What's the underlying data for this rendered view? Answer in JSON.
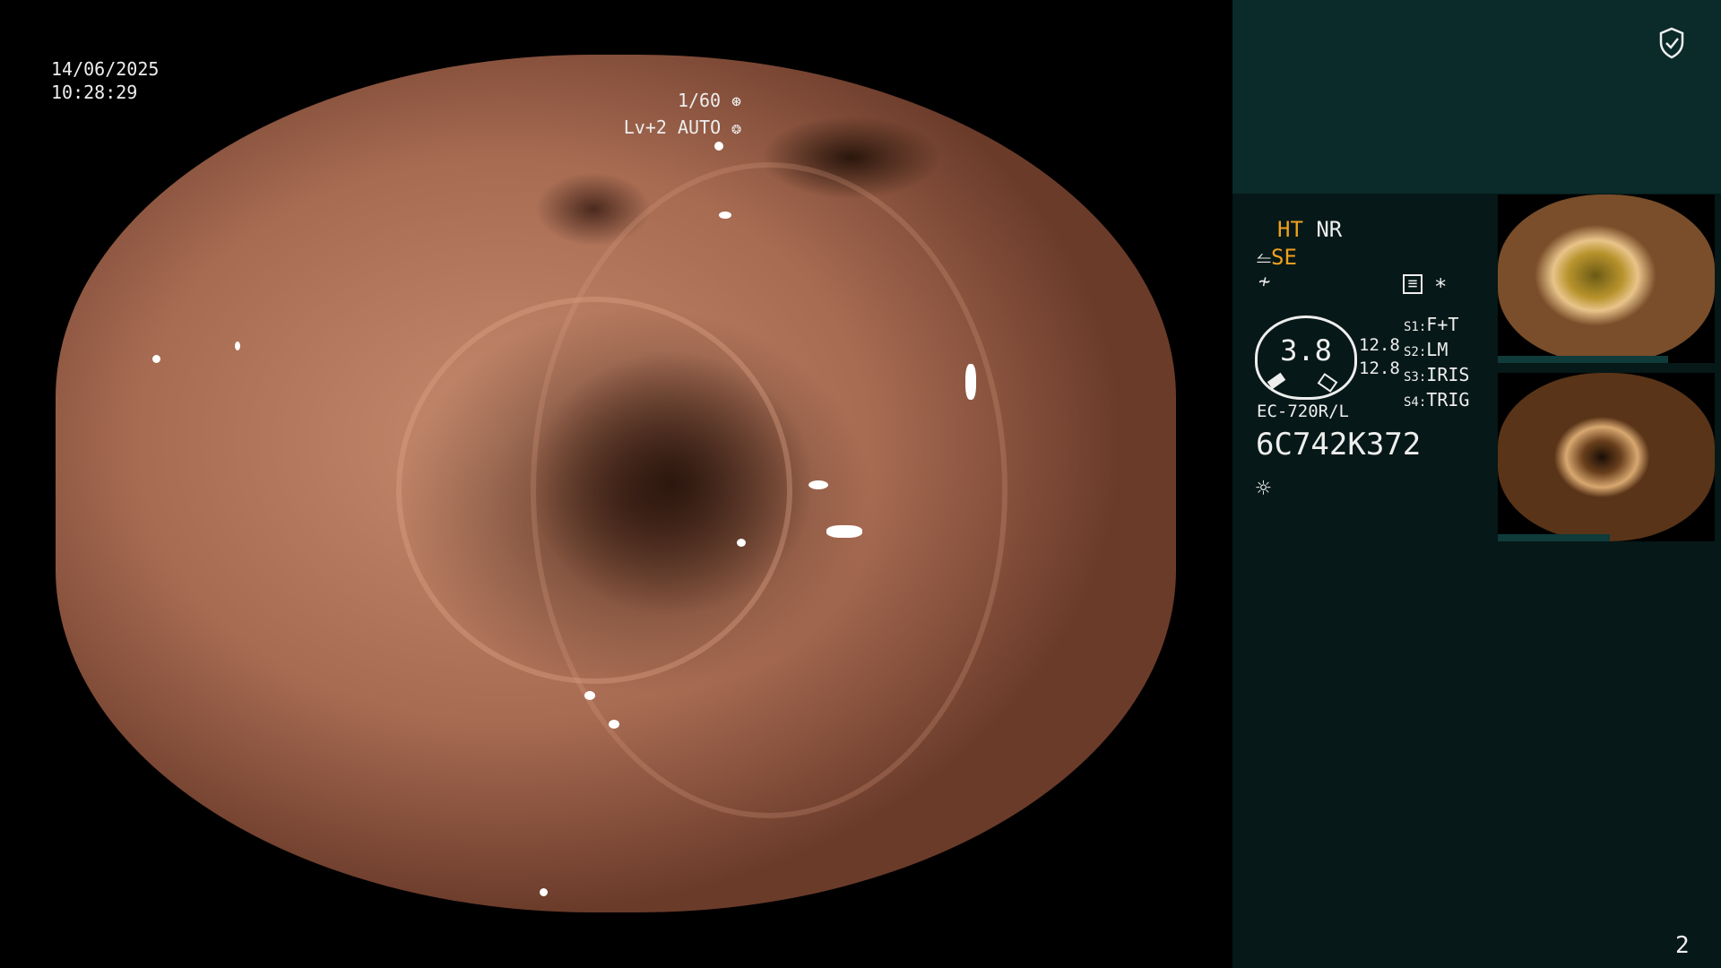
{
  "osd": {
    "date": "14/06/2025",
    "time": "10:28:29",
    "shutter": "1/60",
    "level_mode": "Lv+2 AUTO"
  },
  "panel": {
    "ht": "HT",
    "nr": "NR",
    "se": "SE",
    "asterisk": "*",
    "dial_value": "3.8",
    "scale_a": "12.8",
    "scale_b": "12.8",
    "switches": [
      {
        "key": "S1:",
        "value": "F+T"
      },
      {
        "key": "S2:",
        "value": "LM"
      },
      {
        "key": "S3:",
        "value": "IRIS"
      },
      {
        "key": "S4:",
        "value": "TRIG"
      }
    ],
    "scope_model": "EC-720R/L",
    "serial": "6C742K372",
    "page_number": "2"
  },
  "colors": {
    "panel_top": "#0b2a2a",
    "panel": "#061817",
    "accent_orange": "#f0a020"
  },
  "icons": [
    "shield-check-icon",
    "aperture-icon",
    "iris-icon",
    "squiggle-icon",
    "menu-icon",
    "brightness-icon"
  ]
}
